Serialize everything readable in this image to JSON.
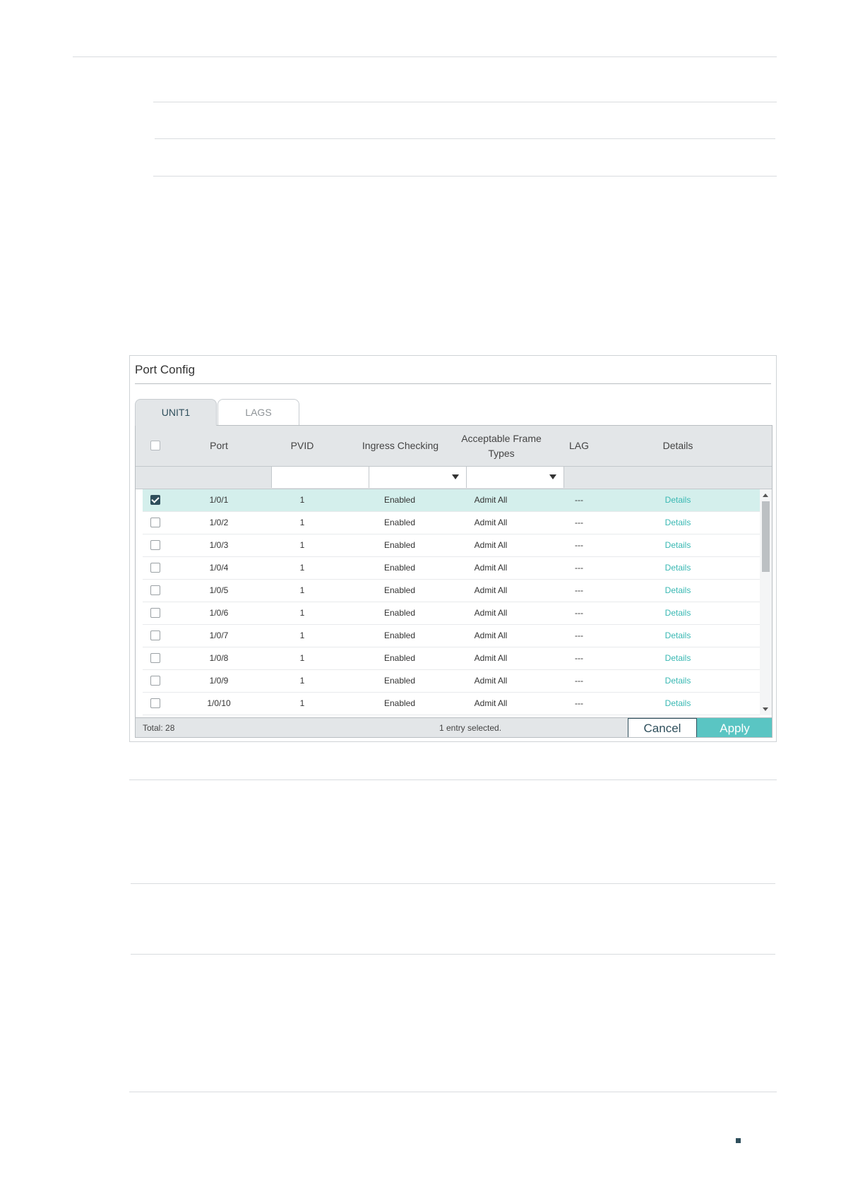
{
  "panel": {
    "title": "Port Config",
    "tabs": [
      {
        "label": "UNIT1",
        "active": true
      },
      {
        "label": "LAGS",
        "active": false
      }
    ]
  },
  "table": {
    "columns": {
      "port": "Port",
      "pvid": "PVID",
      "ingress": "Ingress Checking",
      "frame_types": "Acceptable Frame Types",
      "lag": "LAG",
      "details": "Details"
    },
    "rows": [
      {
        "port": "1/0/1",
        "pvid": "1",
        "ingress": "Enabled",
        "frame_types": "Admit All",
        "lag": "---",
        "details": "Details",
        "checked": true
      },
      {
        "port": "1/0/2",
        "pvid": "1",
        "ingress": "Enabled",
        "frame_types": "Admit All",
        "lag": "---",
        "details": "Details",
        "checked": false
      },
      {
        "port": "1/0/3",
        "pvid": "1",
        "ingress": "Enabled",
        "frame_types": "Admit All",
        "lag": "---",
        "details": "Details",
        "checked": false
      },
      {
        "port": "1/0/4",
        "pvid": "1",
        "ingress": "Enabled",
        "frame_types": "Admit All",
        "lag": "---",
        "details": "Details",
        "checked": false
      },
      {
        "port": "1/0/5",
        "pvid": "1",
        "ingress": "Enabled",
        "frame_types": "Admit All",
        "lag": "---",
        "details": "Details",
        "checked": false
      },
      {
        "port": "1/0/6",
        "pvid": "1",
        "ingress": "Enabled",
        "frame_types": "Admit All",
        "lag": "---",
        "details": "Details",
        "checked": false
      },
      {
        "port": "1/0/7",
        "pvid": "1",
        "ingress": "Enabled",
        "frame_types": "Admit All",
        "lag": "---",
        "details": "Details",
        "checked": false
      },
      {
        "port": "1/0/8",
        "pvid": "1",
        "ingress": "Enabled",
        "frame_types": "Admit All",
        "lag": "---",
        "details": "Details",
        "checked": false
      },
      {
        "port": "1/0/9",
        "pvid": "1",
        "ingress": "Enabled",
        "frame_types": "Admit All",
        "lag": "---",
        "details": "Details",
        "checked": false
      },
      {
        "port": "1/0/10",
        "pvid": "1",
        "ingress": "Enabled",
        "frame_types": "Admit All",
        "lag": "---",
        "details": "Details",
        "checked": false
      }
    ],
    "footer": {
      "total": "Total: 28",
      "selection": "1 entry selected.",
      "cancel_label": "Cancel",
      "apply_label": "Apply"
    }
  },
  "colors": {
    "accent": "#5ac5c3",
    "dark": "#2f4f5c",
    "selected_row": "#d4efec",
    "link": "#39b8b3"
  },
  "icons": {
    "filter_dropdown": "caret-down-icon",
    "scroll": "scroll-arrow-icon"
  }
}
